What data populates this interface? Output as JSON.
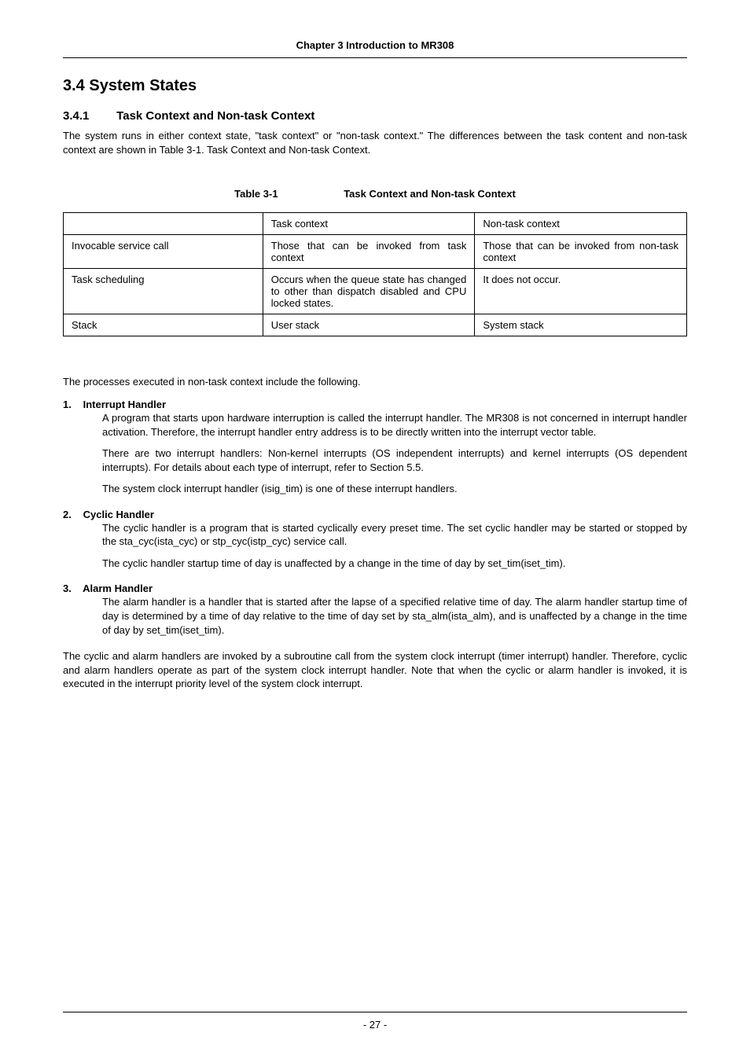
{
  "header": {
    "chapter_title": "Chapter 3 Introduction to MR308"
  },
  "section": {
    "number_title": "3.4  System States"
  },
  "subsection": {
    "number": "3.4.1",
    "title": "Task Context and Non-task Context",
    "intro": "The system runs in either context state, \"task context\" or \"non-task context.\" The differences between the task content and non-task context are shown in Table 3-1. Task Context and Non-task Context."
  },
  "table": {
    "caption_number": "Table 3-1",
    "caption_title": "Task Context and Non-task Context",
    "header": {
      "col1": "",
      "col2": "Task context",
      "col3": "Non-task context"
    },
    "rows": [
      {
        "col1": "Invocable service call",
        "col2": "Those that can be invoked from task context",
        "col3": "Those that can be invoked from non-task context"
      },
      {
        "col1": "Task scheduling",
        "col2": "Occurs when the queue state has changed to other than dispatch disabled and CPU locked states.",
        "col3": "It does not occur."
      },
      {
        "col1": "Stack",
        "col2": "User stack",
        "col3": "System stack"
      }
    ]
  },
  "mid_text": "The processes executed in non-task context include the following.",
  "handlers": [
    {
      "num": "1.",
      "title": "Interrupt Handler",
      "paras": [
        "A program that starts upon hardware interruption is called the interrupt handler. The MR308 is not concerned in interrupt handler activation. Therefore, the interrupt handler entry address is to be directly written into the interrupt vector table.",
        "There are two interrupt handlers: Non-kernel interrupts (OS independent interrupts) and kernel interrupts (OS dependent interrupts). For details about each type of interrupt, refer to Section 5.5.",
        "The system clock interrupt handler (isig_tim) is one of these interrupt handlers."
      ]
    },
    {
      "num": "2.",
      "title": "Cyclic Handler",
      "paras": [
        "The cyclic handler is a program that is started cyclically every preset time. The set cyclic handler may be started or stopped by the sta_cyc(ista_cyc) or stp_cyc(istp_cyc) service call.",
        "The cyclic handler startup time of day is unaffected by a change in the time of day by set_tim(iset_tim)."
      ]
    },
    {
      "num": "3.",
      "title": "Alarm Handler",
      "paras": [
        "The alarm handler is a handler that is started after the lapse of a specified relative time of day. The alarm handler startup time of day is determined by a time of day relative to the time of day set by sta_alm(ista_alm), and is unaffected by a change in the time of day by set_tim(iset_tim)."
      ]
    }
  ],
  "final_para": "The cyclic and alarm handlers are invoked by a subroutine call from the system clock interrupt (timer interrupt) handler. Therefore, cyclic and alarm handlers operate as part of the system clock interrupt handler. Note that when the cyclic or alarm handler is invoked, it is executed in the interrupt priority level of the system clock interrupt.",
  "footer": {
    "page": "- 27 -"
  }
}
